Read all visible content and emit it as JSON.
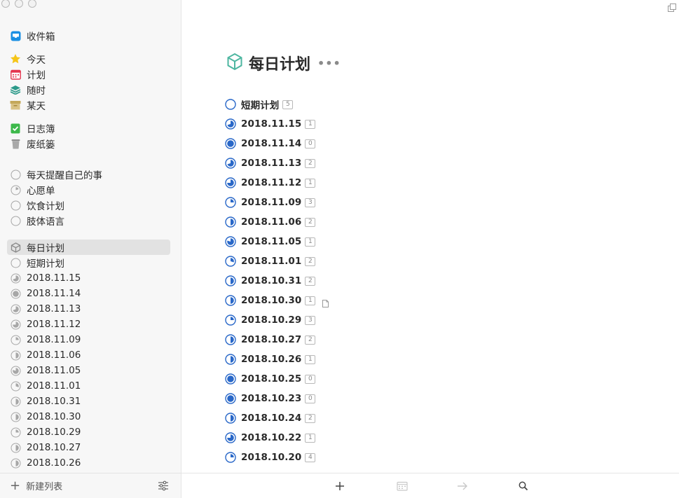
{
  "sidebar": {
    "inbox": "收件箱",
    "today": "今天",
    "upcoming": "计划",
    "anytime": "随时",
    "someday": "某天",
    "logbook": "日志簿",
    "trash": "废纸篓",
    "projects": [
      {
        "label": "每天提醒自己的事",
        "progress": 0
      },
      {
        "label": "心愿单",
        "progress": 0.2
      },
      {
        "label": "饮食计划",
        "progress": 0
      },
      {
        "label": "肢体语言",
        "progress": 0
      }
    ],
    "area_label": "每日计划",
    "area_items": [
      {
        "label": "短期计划",
        "progress": 0
      },
      {
        "label": "2018.11.15",
        "progress": 0.7
      },
      {
        "label": "2018.11.14",
        "progress": 1
      },
      {
        "label": "2018.11.13",
        "progress": 0.7
      },
      {
        "label": "2018.11.12",
        "progress": 0.75
      },
      {
        "label": "2018.11.09",
        "progress": 0.25
      },
      {
        "label": "2018.11.06",
        "progress": 0.5
      },
      {
        "label": "2018.11.05",
        "progress": 0.8
      },
      {
        "label": "2018.11.01",
        "progress": 0.3
      },
      {
        "label": "2018.10.31",
        "progress": 0.5
      },
      {
        "label": "2018.10.30",
        "progress": 0.5
      },
      {
        "label": "2018.10.29",
        "progress": 0.25
      },
      {
        "label": "2018.10.27",
        "progress": 0.5
      },
      {
        "label": "2018.10.26",
        "progress": 0.5
      }
    ],
    "new_list": "新建列表"
  },
  "main": {
    "title": "每日计划",
    "more": "•••",
    "items": [
      {
        "label": "短期计划",
        "count": "5",
        "progress": 0
      },
      {
        "label": "2018.11.15",
        "count": "1",
        "progress": 0.7
      },
      {
        "label": "2018.11.14",
        "count": "0",
        "progress": 1
      },
      {
        "label": "2018.11.13",
        "count": "2",
        "progress": 0.7
      },
      {
        "label": "2018.11.12",
        "count": "1",
        "progress": 0.75
      },
      {
        "label": "2018.11.09",
        "count": "3",
        "progress": 0.25
      },
      {
        "label": "2018.11.06",
        "count": "2",
        "progress": 0.5
      },
      {
        "label": "2018.11.05",
        "count": "1",
        "progress": 0.8
      },
      {
        "label": "2018.11.01",
        "count": "2",
        "progress": 0.3
      },
      {
        "label": "2018.10.31",
        "count": "2",
        "progress": 0.5
      },
      {
        "label": "2018.10.30",
        "count": "1",
        "progress": 0.5,
        "note": true
      },
      {
        "label": "2018.10.29",
        "count": "3",
        "progress": 0.25
      },
      {
        "label": "2018.10.27",
        "count": "2",
        "progress": 0.5
      },
      {
        "label": "2018.10.26",
        "count": "1",
        "progress": 0.5
      },
      {
        "label": "2018.10.25",
        "count": "0",
        "progress": 1
      },
      {
        "label": "2018.10.23",
        "count": "0",
        "progress": 1
      },
      {
        "label": "2018.10.24",
        "count": "2",
        "progress": 0.5
      },
      {
        "label": "2018.10.22",
        "count": "1",
        "progress": 0.75
      },
      {
        "label": "2018.10.20",
        "count": "4",
        "progress": 0.25
      }
    ]
  },
  "colors": {
    "accent": "#2867c8",
    "sidebar_pie": "#a7a7a7",
    "area_icon": "#4db6a0",
    "inbox": "#1a8fe3",
    "today": "#f5c518",
    "upcoming": "#e4344e",
    "anytime": "#2c9a8a",
    "someday": "#cdb268",
    "logbook": "#3cb84a",
    "trash": "#9a9a9a"
  },
  "toolbar": {
    "icons": [
      "plus-icon",
      "calendar-icon",
      "arrow-right-icon",
      "search-icon"
    ]
  }
}
